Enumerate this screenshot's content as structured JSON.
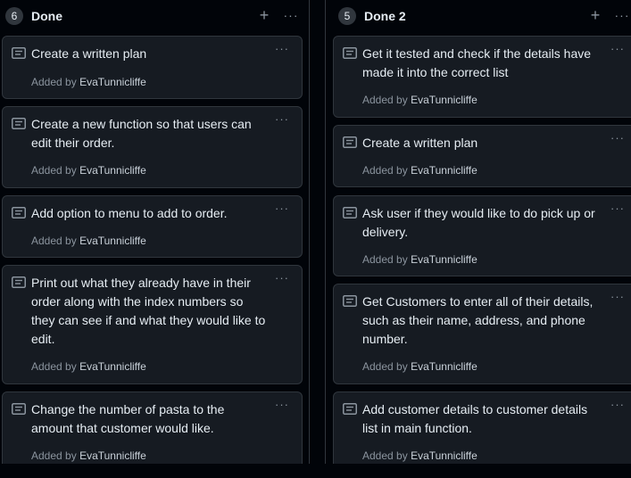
{
  "columns": [
    {
      "count": "6",
      "title": "Done",
      "add_icon": "plus-icon",
      "more_icon": "kebab-horizontal-icon",
      "cards": [
        {
          "title": "Create a written plan",
          "added_by_label": "Added by",
          "author": "EvaTunnicliffe"
        },
        {
          "title": "Create a new function so that users can edit their order.",
          "added_by_label": "Added by",
          "author": "EvaTunnicliffe"
        },
        {
          "title": "Add option to menu to add to order.",
          "added_by_label": "Added by",
          "author": "EvaTunnicliffe"
        },
        {
          "title": "Print out what they already have in their order along with the index numbers so they can see if and what they would like to edit.",
          "added_by_label": "Added by",
          "author": "EvaTunnicliffe"
        },
        {
          "title": "Change the number of pasta to the amount that customer would like.",
          "added_by_label": "Added by",
          "author": "EvaTunnicliffe"
        }
      ]
    },
    {
      "count": "5",
      "title": "Done 2",
      "add_icon": "plus-icon",
      "more_icon": "kebab-horizontal-icon",
      "cards": [
        {
          "title": "Get it tested and check if the details have made it into the correct list",
          "added_by_label": "Added by",
          "author": "EvaTunnicliffe"
        },
        {
          "title": "Create a written plan",
          "added_by_label": "Added by",
          "author": "EvaTunnicliffe"
        },
        {
          "title": "Ask user if they would like to do pick up or delivery.",
          "added_by_label": "Added by",
          "author": "EvaTunnicliffe"
        },
        {
          "title": "Get Customers to enter all of their details, such as their name, address, and phone number.",
          "added_by_label": "Added by",
          "author": "EvaTunnicliffe"
        },
        {
          "title": "Add customer details to customer details list in main function.",
          "added_by_label": "Added by",
          "author": "EvaTunnicliffe"
        }
      ]
    }
  ],
  "icons": {
    "plus": "+",
    "more": "···",
    "card_icon": "note-icon"
  },
  "colors": {
    "background": "#010409",
    "card": "#161b22",
    "border": "#30363d",
    "text": "#e6edf3",
    "muted": "#8b949e"
  }
}
